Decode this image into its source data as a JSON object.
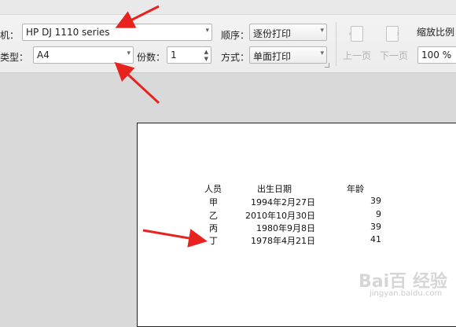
{
  "toolbar": {
    "printer_label": "机：",
    "printer_value": "HP DJ 1110 series",
    "paper_label": "类型：",
    "paper_value": "A4",
    "copies_label": "份数：",
    "copies_value": "1",
    "order_label": "顺序：",
    "order_value": "逐份打印",
    "mode_label": "方式：",
    "mode_value": "单面打印",
    "prev_label": "上一页",
    "next_label": "下一页",
    "zoom_label": "缩放比例",
    "zoom_value": "100 %"
  },
  "preview": {
    "headers": [
      "人员",
      "出生日期",
      "年龄"
    ],
    "rows": [
      {
        "name": "甲",
        "date": "1994年2月27日",
        "age": "39"
      },
      {
        "name": "乙",
        "date": "2010年10月30日",
        "age": "9"
      },
      {
        "name": "丙",
        "date": "1980年9月8日",
        "age": "39"
      },
      {
        "name": "丁",
        "date": "1978年4月21日",
        "age": "41"
      }
    ]
  },
  "watermark": {
    "brand": "Bai百 经验",
    "url": "jingyan.baidu.com"
  },
  "colors": {
    "annotation_arrow": "#e8231f"
  }
}
